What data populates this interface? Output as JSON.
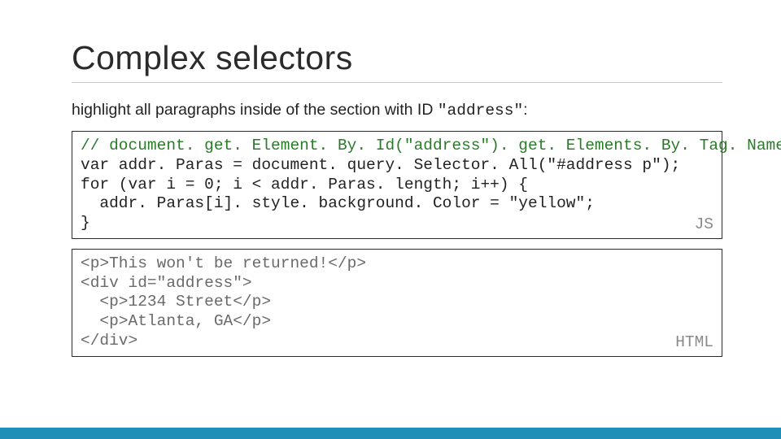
{
  "title": "Complex selectors",
  "subtitle_prefix": "highlight all paragraphs inside of the section with ID ",
  "subtitle_code": "\"address\"",
  "subtitle_suffix": ":",
  "js_box": {
    "comment": "// document. get. Element. By. Id(\"address\"). get. Elements. By. Tag. Name(\"p\")",
    "line2": "var addr. Paras = document. query. Selector. All(\"#address p\");",
    "line3": "for (var i = 0; i < addr. Paras. length; i++) {",
    "line4": "  addr. Paras[i]. style. background. Color = \"yellow\";",
    "line5": "}",
    "badge": "JS"
  },
  "html_box": {
    "line1": "<p>This won't be returned!</p>",
    "line2": "<div id=\"address\">",
    "line3": "  <p>1234 Street</p>",
    "line4": "  <p>Atlanta, GA</p>",
    "line5": "</div>",
    "badge": "HTML"
  },
  "colors": {
    "accent_bar": "#1f8fb8",
    "comment": "#2a7a2a",
    "badge": "#8a8a8a"
  }
}
